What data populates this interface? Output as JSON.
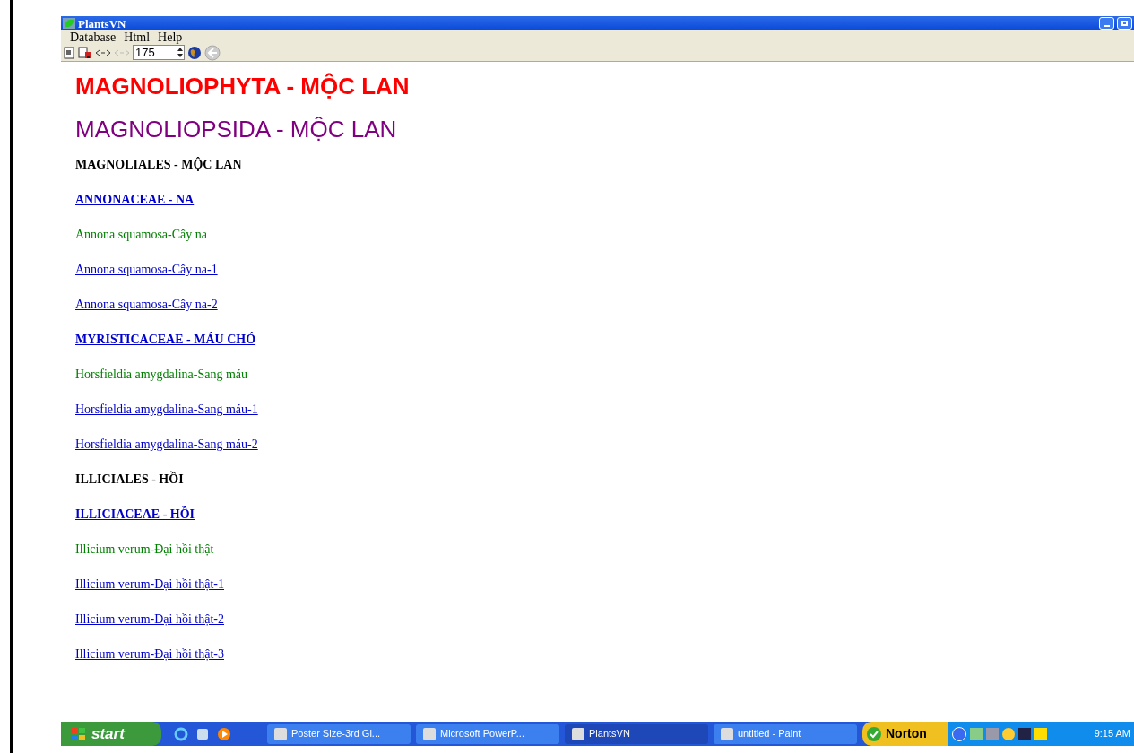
{
  "window": {
    "title": "PlantsVN"
  },
  "menu": [
    "Database",
    "Html",
    "Help"
  ],
  "toolbar": {
    "page_field": "175"
  },
  "content": [
    {
      "kind": "division",
      "text": "MAGNOLIOPHYTA - MỘC LAN"
    },
    {
      "kind": "class",
      "text": "MAGNOLIOPSIDA - MỘC LAN"
    },
    {
      "kind": "order",
      "text": "MAGNOLIALES - MỘC LAN"
    },
    {
      "kind": "family",
      "text": "ANNONACEAE - NA"
    },
    {
      "kind": "species",
      "text": "Annona squamosa-Cây na"
    },
    {
      "kind": "link",
      "text": "Annona squamosa-Cây na-1"
    },
    {
      "kind": "link",
      "text": "Annona squamosa-Cây na-2"
    },
    {
      "kind": "family",
      "text": "MYRISTICACEAE - MÁU CHÓ"
    },
    {
      "kind": "species",
      "text": "Horsfieldia amygdalina-Sang máu"
    },
    {
      "kind": "link",
      "text": "Horsfieldia amygdalina-Sang máu-1"
    },
    {
      "kind": "link",
      "text": "Horsfieldia amygdalina-Sang máu-2"
    },
    {
      "kind": "order",
      "text": "ILLICIALES - HỒI"
    },
    {
      "kind": "family",
      "text": "ILLICIACEAE - HỒI"
    },
    {
      "kind": "species",
      "text": "Illicium verum-Đại hồi thật"
    },
    {
      "kind": "link",
      "text": "Illicium verum-Đại hồi thật-1"
    },
    {
      "kind": "link",
      "text": "Illicium verum-Đại hồi thật-2"
    },
    {
      "kind": "link",
      "text": "Illicium verum-Đại hồi thật-3"
    }
  ],
  "taskbar": {
    "start": "start",
    "tasks": [
      {
        "label": "Poster Size-3rd Gl...",
        "selected": false
      },
      {
        "label": "Microsoft PowerP...",
        "selected": false
      },
      {
        "label": "PlantsVN",
        "selected": true
      },
      {
        "label": "untitled - Paint",
        "selected": false
      }
    ],
    "norton": "Norton",
    "clock": "9:15 AM"
  }
}
